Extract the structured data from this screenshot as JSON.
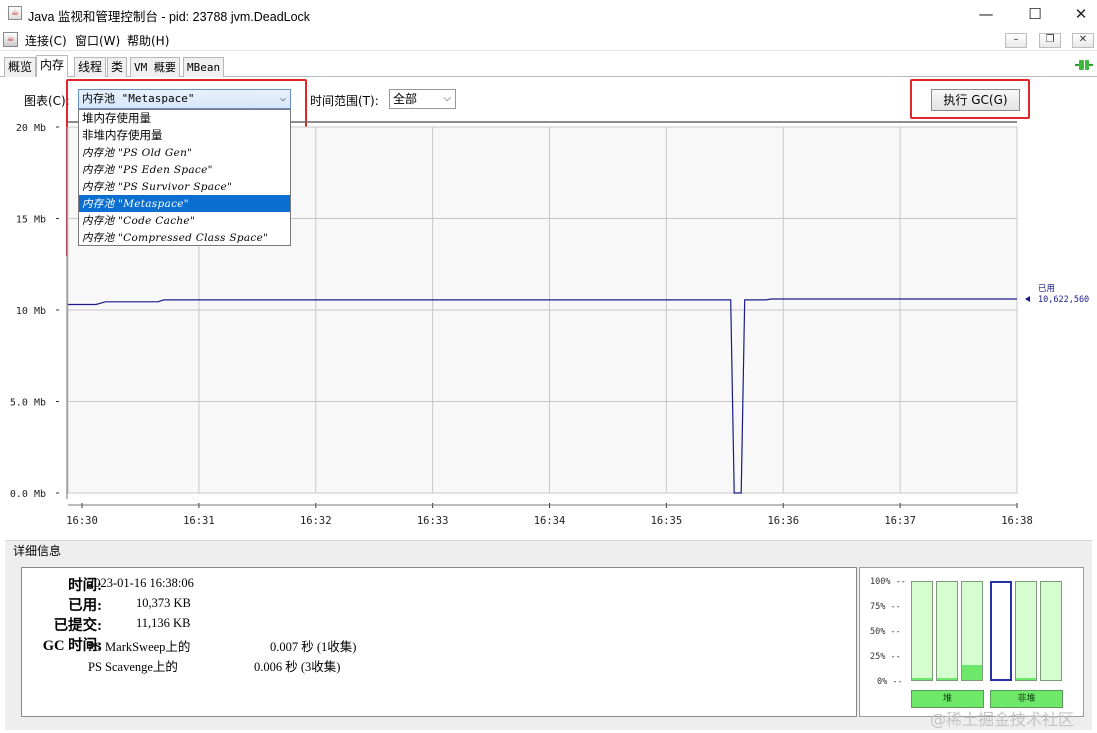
{
  "window": {
    "title": "Java 监视和管理控制台 - pid: 23788 jvm.DeadLock",
    "minimize": "—",
    "maximize": "☐",
    "close": "✕"
  },
  "menubar": {
    "items": [
      "连接(C)",
      "窗口(W)",
      "帮助(H)"
    ],
    "mdi_minimize": "–",
    "mdi_restore": "❐",
    "mdi_close": "✕"
  },
  "tabs": [
    "概览",
    "内存",
    "线程",
    "类",
    "VM 概要",
    "MBean"
  ],
  "active_tab": "内存",
  "toolbar": {
    "chart_label": "图表(C):",
    "chart_value": "内存池 \"Metaspace\"",
    "range_label": "时间范围(T):",
    "range_value": "全部",
    "gc_button": "执行 GC(G)"
  },
  "dropdown": {
    "options": [
      "堆内存使用量",
      "非堆内存使用量",
      "内存池 \"PS Old Gen\"",
      "内存池 \"PS Eden Space\"",
      "内存池 \"PS Survivor Space\"",
      "内存池 \"Metaspace\"",
      "内存池 \"Code Cache\"",
      "内存池 \"Compressed Class Space\""
    ],
    "selected_index": 5
  },
  "chart_data": {
    "type": "line",
    "ylim": [
      0,
      20
    ],
    "yticks": [
      "0.0 Mb",
      "5.0 Mb",
      "10 Mb",
      "15 Mb",
      "20 Mb"
    ],
    "xticks": [
      "16:30",
      "16:31",
      "16:32",
      "16:33",
      "16:34",
      "16:35",
      "16:36",
      "16:37",
      "16:38"
    ],
    "xlim_minutes": [
      -0.12,
      8.0
    ],
    "grid": true,
    "series": [
      {
        "name": "已用",
        "color": "#1a1a8c",
        "points": [
          [
            -0.12,
            10.3
          ],
          [
            0.12,
            10.3
          ],
          [
            0.2,
            10.45
          ],
          [
            0.65,
            10.45
          ],
          [
            0.7,
            10.55
          ],
          [
            5.55,
            10.55
          ],
          [
            5.58,
            0.0
          ],
          [
            5.64,
            0.0
          ],
          [
            5.67,
            10.55
          ],
          [
            5.85,
            10.55
          ],
          [
            5.9,
            10.6
          ],
          [
            8.0,
            10.6
          ]
        ]
      }
    ],
    "current_label": "已用",
    "current_value": "10,622,560"
  },
  "details": {
    "title": "详细信息",
    "time_key": "时间:",
    "time_val": "2023-01-16 16:38:06",
    "used_key": "已用:",
    "used_val": "10,373 KB",
    "committed_key": "已提交:",
    "committed_val": "11,136 KB",
    "gc_key": "GC 时间:",
    "gc_rows": [
      {
        "name": "PS MarkSweep上的",
        "value": "0.007 秒 (1收集)"
      },
      {
        "name": "PS Scavenge上的",
        "value": "0.006 秒 (3收集)"
      }
    ]
  },
  "bars": {
    "pct_labels": [
      "100% --",
      "75% --",
      "50% --",
      "25% --",
      "0% --"
    ],
    "levels": [
      0.02,
      0.02,
      0.15,
      0.0,
      0.02,
      0.0
    ],
    "selected_index": 3,
    "heap_label": "堆",
    "nonheap_label": "非堆"
  },
  "watermark": "@稀土掘金技术社区"
}
